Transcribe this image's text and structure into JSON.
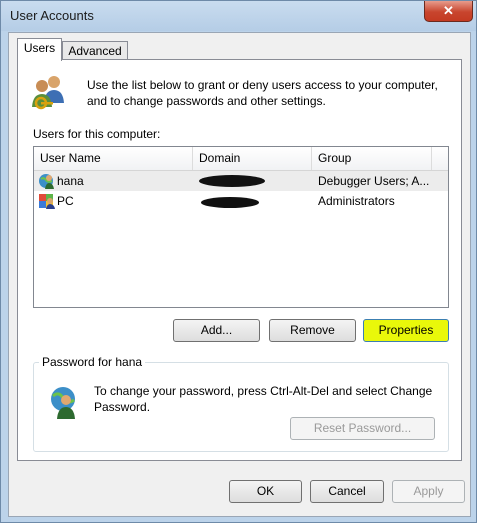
{
  "window": {
    "title": "User Accounts",
    "close_glyph": "✕"
  },
  "tabs": [
    {
      "label": "Users"
    },
    {
      "label": "Advanced"
    }
  ],
  "intro_text": "Use the list below to grant or deny users access to your computer, and to change passwords and other settings.",
  "users_list": {
    "label": "Users for this computer:",
    "columns": [
      "User Name",
      "Domain",
      "Group"
    ],
    "rows": [
      {
        "name": "hana",
        "domain": "",
        "group": "Debugger Users; A...",
        "selected": true,
        "icon": "user-domain-icon"
      },
      {
        "name": "PC",
        "domain": "",
        "group": "Administrators",
        "selected": false,
        "icon": "user-admin-icon"
      }
    ]
  },
  "buttons": {
    "add": "Add...",
    "remove": "Remove",
    "properties": "Properties"
  },
  "password_group": {
    "title": "Password for hana",
    "text": "To change your password, press Ctrl-Alt-Del and select Change Password.",
    "reset_button": "Reset Password..."
  },
  "footer": {
    "ok": "OK",
    "cancel": "Cancel",
    "apply": "Apply"
  },
  "colors": {
    "highlight_button": "#e9f80a",
    "window_frame": "#bcd3ea"
  }
}
